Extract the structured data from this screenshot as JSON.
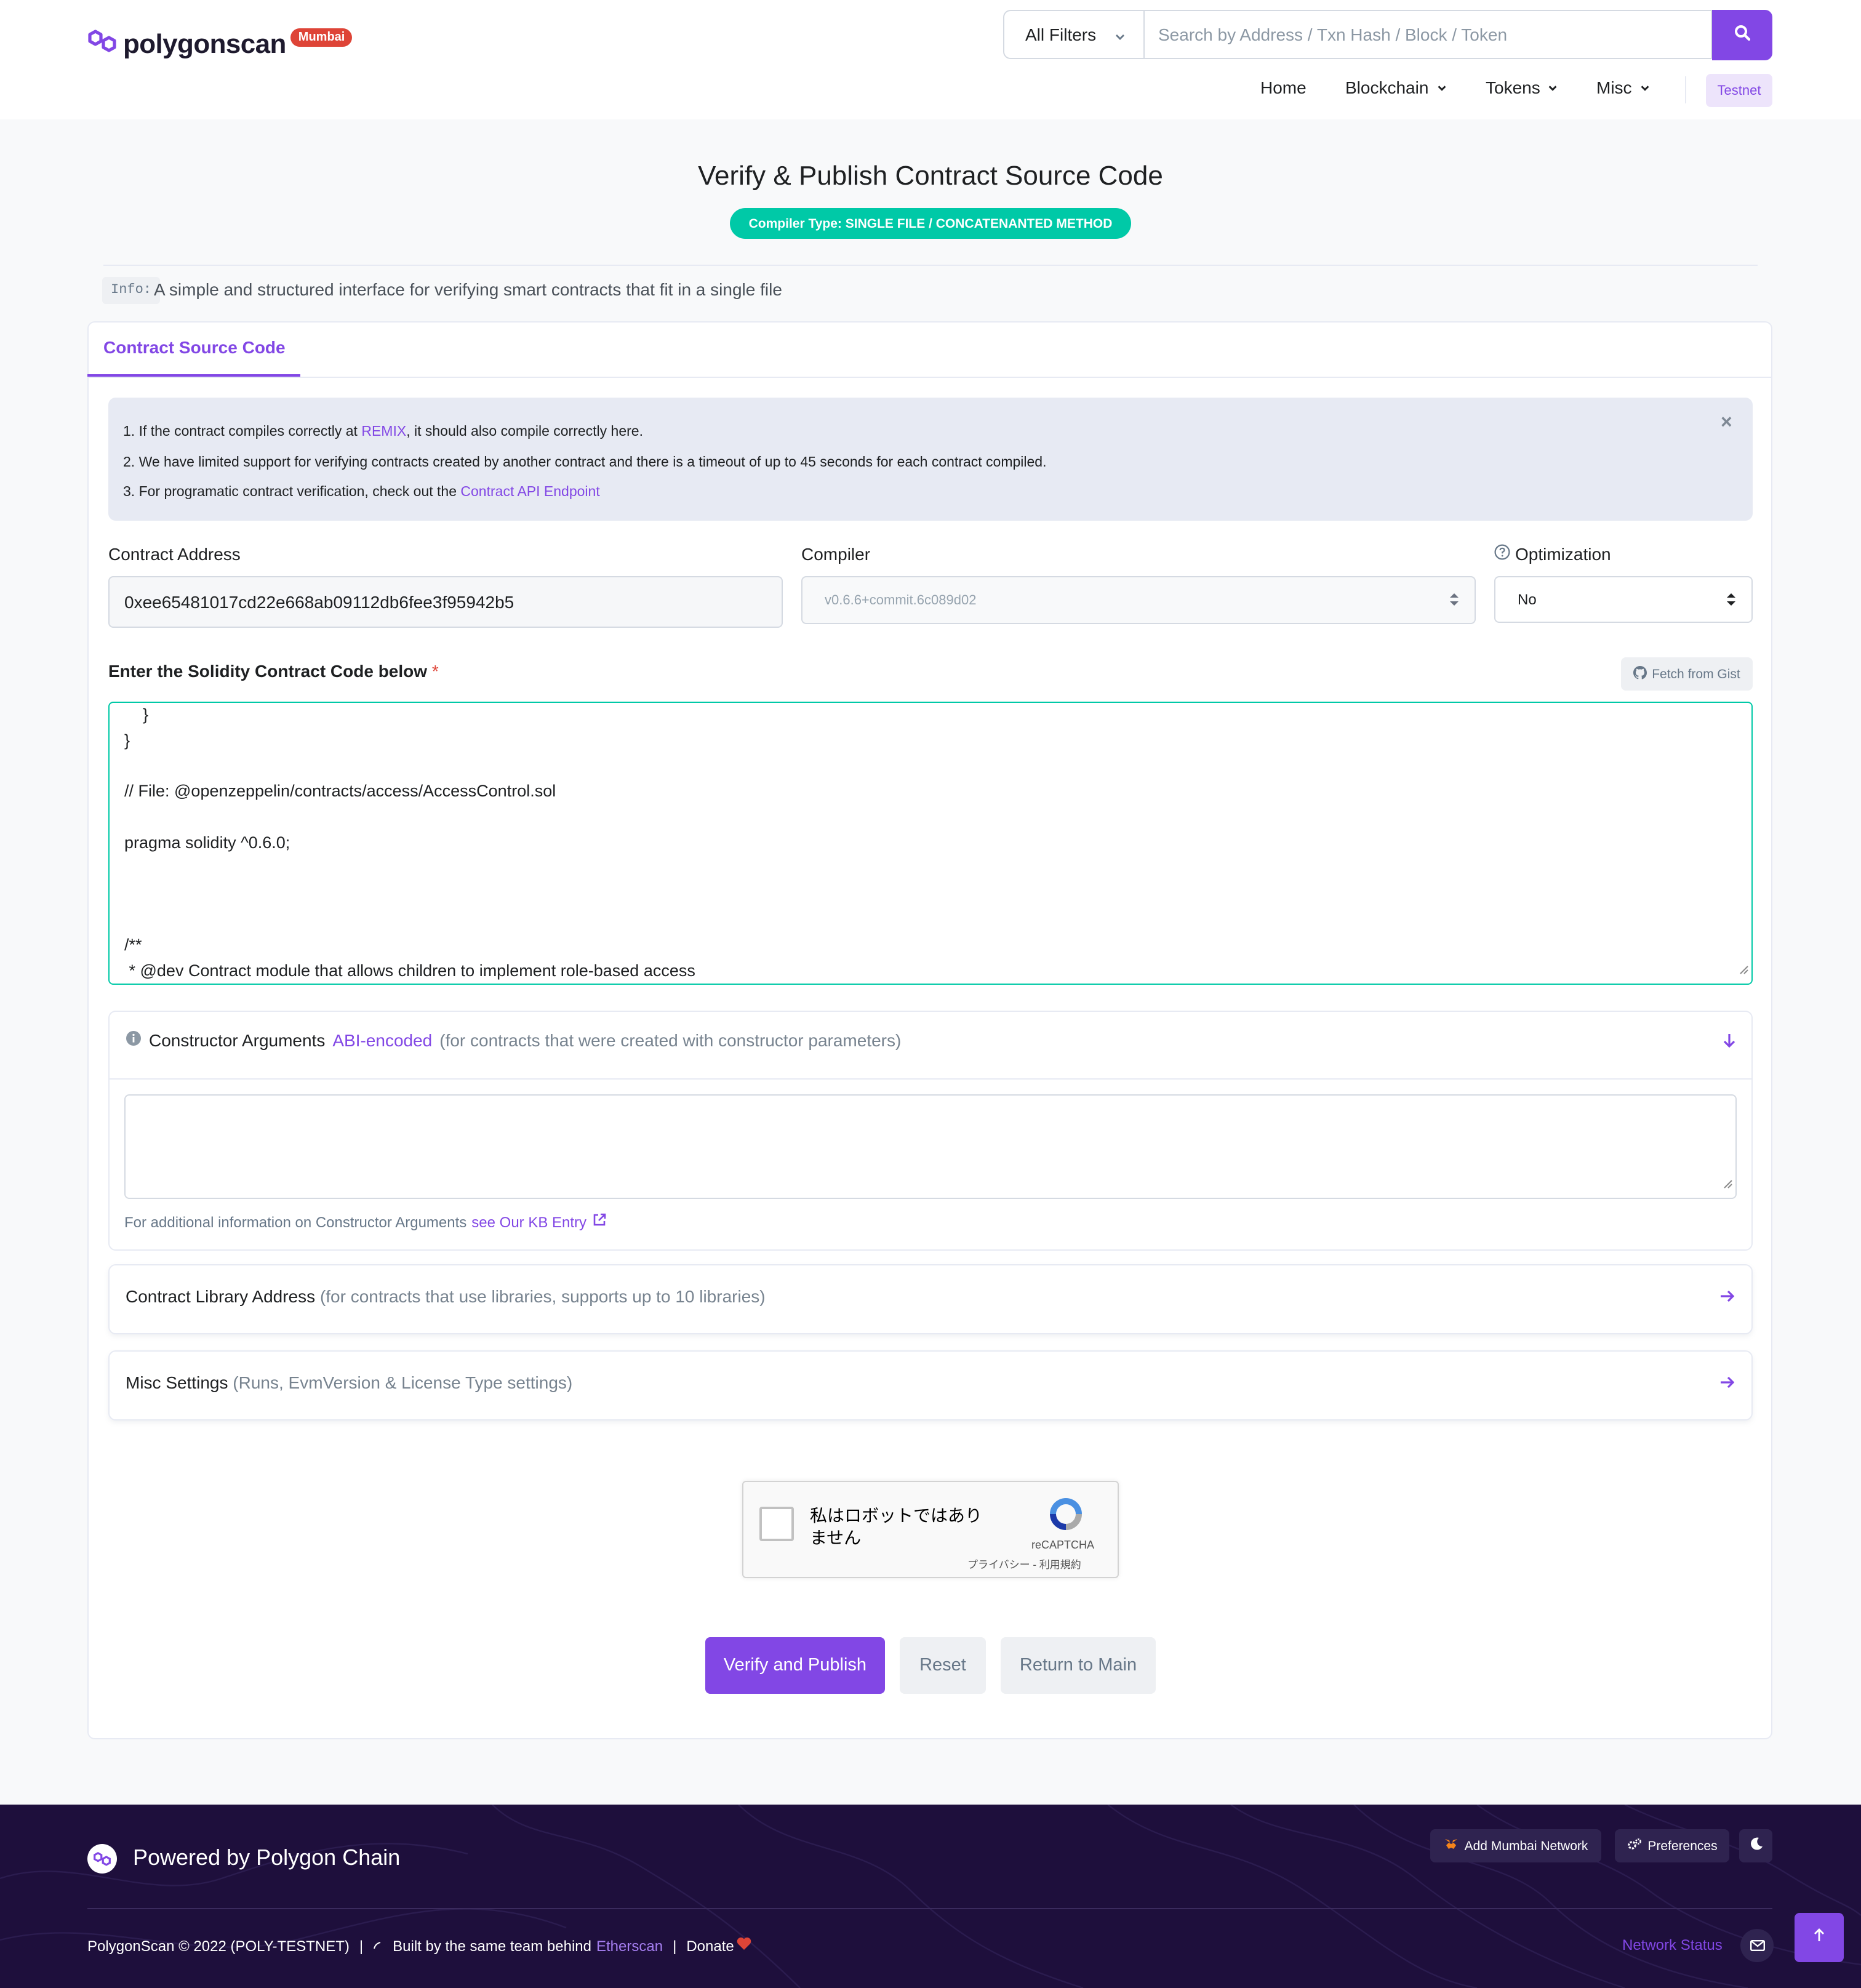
{
  "brand": {
    "name": "polygonscan",
    "network_badge": "Mumbai"
  },
  "search": {
    "filter_label": "All Filters",
    "placeholder": "Search by Address / Txn Hash / Block / Token"
  },
  "nav": {
    "home": "Home",
    "blockchain": "Blockchain",
    "tokens": "Tokens",
    "misc": "Misc",
    "testnet": "Testnet"
  },
  "page": {
    "title": "Verify & Publish Contract Source Code",
    "compiler_type": "Compiler Type: SINGLE FILE / CONCATENANTED METHOD",
    "info_tag": "Info:",
    "info_text": "A simple and structured interface for verifying smart contracts that fit in a single file"
  },
  "tabs": {
    "active": "Contract Source Code"
  },
  "notice": {
    "line1_prefix": "1. If the contract compiles correctly at ",
    "line1_link": "REMIX",
    "line1_suffix": ", it should also compile correctly here.",
    "line2": "2. We have limited support for verifying contracts created by another contract and there is a timeout of up to 45 seconds for each contract compiled.",
    "line3_prefix": "3. For programatic contract verification, check out the ",
    "line3_link": "Contract API Endpoint",
    "close": "×"
  },
  "form": {
    "address_label": "Contract Address",
    "address_value": "0xee65481017cd22e668ab09112db6fee3f95942b5",
    "compiler_label": "Compiler",
    "compiler_value": "v0.6.6+commit.6c089d02",
    "optimization_label": "Optimization",
    "optimization_value": "No",
    "code_label": "Enter the Solidity Contract Code below",
    "required_mark": "*",
    "gist_button": "Fetch from Gist",
    "code_lines": [
      "    }",
      "}",
      "",
      "// File: @openzeppelin/contracts/access/AccessControl.sol",
      "",
      "pragma solidity ^0.6.0;",
      "",
      "",
      "",
      "/**",
      " * @dev Contract module that allows children to implement role-based access"
    ]
  },
  "constructor": {
    "title": "Constructor Arguments",
    "link": "ABI-encoded",
    "hint": "(for contracts that were created with constructor parameters)",
    "note_prefix": "For additional information on Constructor Arguments",
    "note_link": "see Our KB Entry"
  },
  "library": {
    "title": "Contract Library Address",
    "hint": "(for contracts that use libraries, supports up to 10 libraries)"
  },
  "misc": {
    "title": "Misc Settings",
    "hint": "(Runs, EvmVersion & License Type settings)"
  },
  "captcha": {
    "text": "私はロボットではありません",
    "brand": "reCAPTCHA",
    "links": "プライバシー - 利用規約"
  },
  "actions": {
    "verify": "Verify and Publish",
    "reset": "Reset",
    "return": "Return to Main"
  },
  "footer": {
    "powered": "Powered by Polygon Chain",
    "add_network": "Add Mumbai Network",
    "preferences": "Preferences",
    "copyright": "PolygonScan © 2022 (POLY-TESTNET)",
    "sep": "|",
    "built_by": "Built by the same team behind",
    "etherscan": "Etherscan",
    "donate": "Donate",
    "network_status": "Network Status"
  },
  "colors": {
    "accent": "#8247e5",
    "success": "#00c9a7",
    "danger": "#de4437",
    "footer_bg": "#1e0f3c"
  }
}
